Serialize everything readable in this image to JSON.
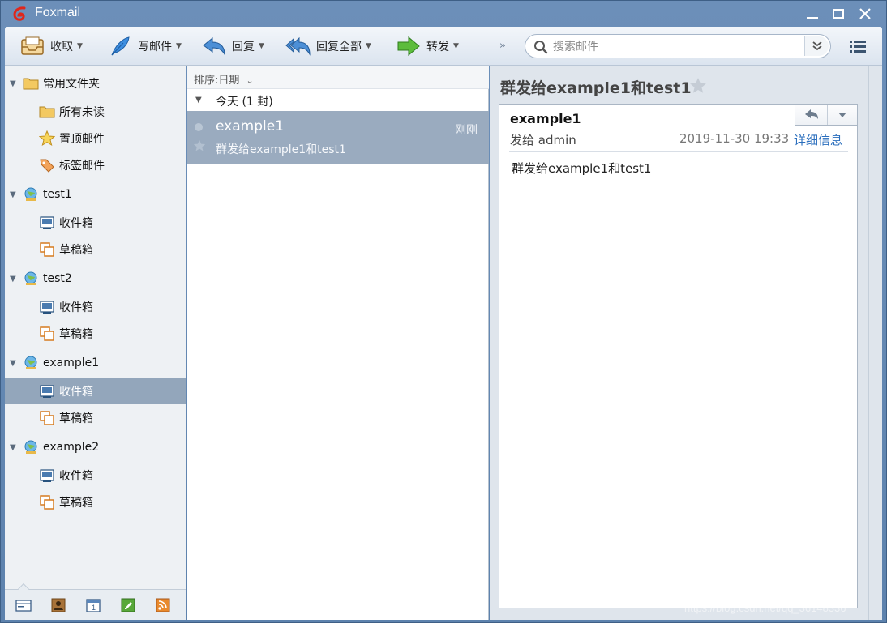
{
  "window": {
    "title": "Foxmail",
    "accent": "#5d82ad",
    "logo_color": "#e0261b"
  },
  "toolbar": {
    "receive": "收取",
    "compose": "写邮件",
    "reply": "回复",
    "reply_all": "回复全部",
    "forward": "转发",
    "more": "»",
    "search_placeholder": "搜索邮件"
  },
  "sidebar": {
    "common": {
      "label": "常用文件夹",
      "items": [
        "所有未读",
        "置顶邮件",
        "标签邮件"
      ]
    },
    "accounts": [
      {
        "name": "test1",
        "inbox": "收件箱",
        "drafts": "草稿箱"
      },
      {
        "name": "test2",
        "inbox": "收件箱",
        "drafts": "草稿箱"
      },
      {
        "name": "example1",
        "inbox": "收件箱",
        "drafts": "草稿箱"
      },
      {
        "name": "example2",
        "inbox": "收件箱",
        "drafts": "草稿箱"
      }
    ],
    "selected": "example1 / 收件箱",
    "bottom_tabs": [
      "mail-icon",
      "contacts-icon",
      "calendar-icon",
      "notes-icon",
      "rss-icon"
    ]
  },
  "message_list": {
    "sort_label": "排序:日期",
    "group_label": "今天 (1 封)",
    "items": [
      {
        "sender": "example1",
        "time": "刚刚",
        "subject": "群发给example1和test1"
      }
    ]
  },
  "reader": {
    "title": "群发给example1和test1",
    "sender": "example1",
    "to": "发给 admin",
    "date": "2019-11-30 19:33",
    "detail_link": "详细信息",
    "body": "群发给example1和test1"
  },
  "watermark": "https://blog.csdn.net/qq_36148336"
}
